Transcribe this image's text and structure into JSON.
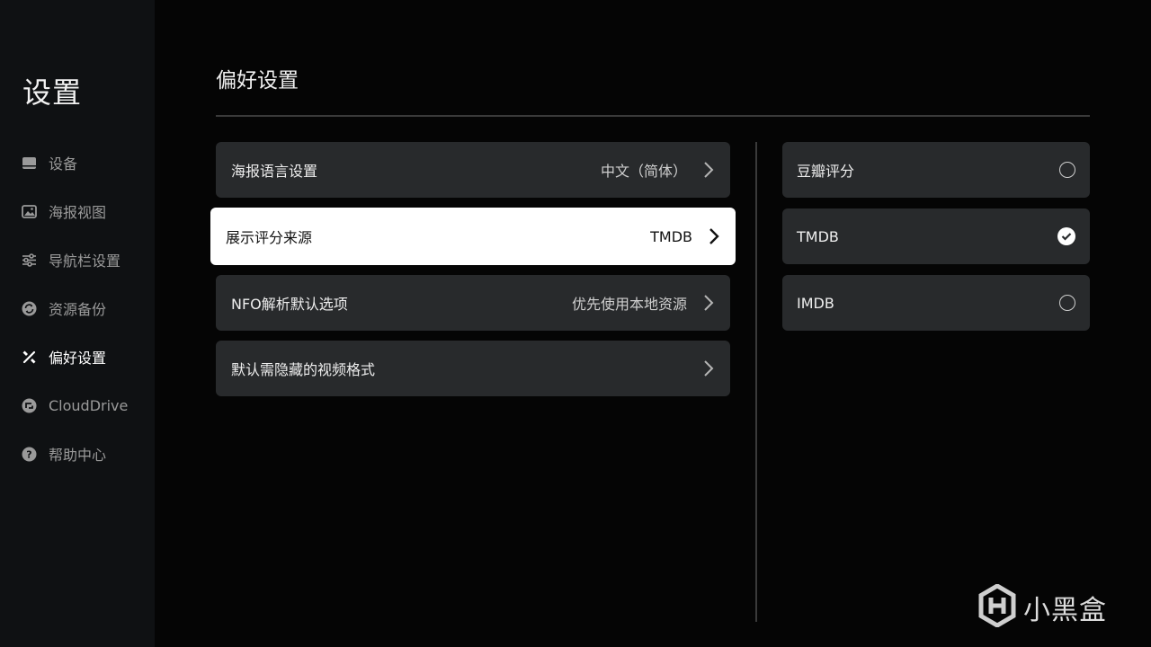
{
  "sidebar": {
    "title": "设置",
    "items": [
      {
        "label": "设备",
        "icon": "device-icon"
      },
      {
        "label": "海报视图",
        "icon": "image-icon"
      },
      {
        "label": "导航栏设置",
        "icon": "sliders-icon"
      },
      {
        "label": "资源备份",
        "icon": "sync-icon"
      },
      {
        "label": "偏好设置",
        "icon": "tools-icon",
        "active": true
      },
      {
        "label": "CloudDrive",
        "icon": "cloud-drive-icon"
      },
      {
        "label": "帮助中心",
        "icon": "help-icon"
      }
    ]
  },
  "main": {
    "title": "偏好设置",
    "settings": [
      {
        "label": "海报语言设置",
        "value": "中文（简体）"
      },
      {
        "label": "展示评分来源",
        "value": "TMDB",
        "focused": true
      },
      {
        "label": "NFO解析默认选项",
        "value": "优先使用本地资源"
      },
      {
        "label": "默认需隐藏的视频格式",
        "value": ""
      }
    ]
  },
  "options": {
    "items": [
      {
        "label": "豆瓣评分",
        "selected": false
      },
      {
        "label": "TMDB",
        "selected": true
      },
      {
        "label": "IMDB",
        "selected": false
      }
    ]
  },
  "watermark": {
    "text": "小黑盒"
  },
  "colors": {
    "background": "#050505",
    "sidebar": "#0f1113",
    "row": "#282a2c",
    "focused_row": "#ffffff"
  }
}
